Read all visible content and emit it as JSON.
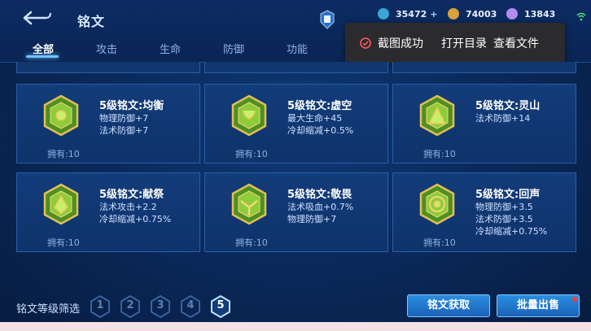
{
  "header": {
    "title": "铭文",
    "tabs": [
      {
        "label": "全部",
        "active": true
      },
      {
        "label": "攻击",
        "active": false
      },
      {
        "label": "生命",
        "active": false
      },
      {
        "label": "防御",
        "active": false
      },
      {
        "label": "功能",
        "active": false
      }
    ]
  },
  "currencies": [
    {
      "icon": "diamond-coupon-icon",
      "value": "35472",
      "plus": "+"
    },
    {
      "icon": "gold-coin-icon",
      "value": "74003"
    },
    {
      "icon": "crystal-icon",
      "value": "13843"
    }
  ],
  "toast": {
    "message": "截图成功",
    "open_dir": "打开目录",
    "view_file": "查看文件",
    "icon": "check-circle-icon"
  },
  "runes": [
    {
      "name": "5级铭文:均衡",
      "stats": [
        "物理防御+7",
        "法术防御+7"
      ],
      "owned": "拥有:10",
      "icon": "rune-balance-icon"
    },
    {
      "name": "5级铭文:虚空",
      "stats": [
        "最大生命+45",
        "冷却缩减+0.5%"
      ],
      "owned": "拥有:10",
      "icon": "rune-void-icon"
    },
    {
      "name": "5级铭文:灵山",
      "stats": [
        "法术防御+14"
      ],
      "owned": "拥有:10",
      "icon": "rune-spirit-mountain-icon"
    },
    {
      "name": "5级铭文:献祭",
      "stats": [
        "法术攻击+2.2",
        "冷却缩减+0.75%"
      ],
      "owned": "拥有:10",
      "icon": "rune-sacrifice-icon"
    },
    {
      "name": "5级铭文:敬畏",
      "stats": [
        "法术吸血+0.7%",
        "物理防御+7"
      ],
      "owned": "拥有:10",
      "icon": "rune-awe-icon"
    },
    {
      "name": "5级铭文:回声",
      "stats": [
        "物理防御+3.5",
        "法术防御+3.5",
        "冷却缩减+0.75%"
      ],
      "owned": "拥有:10",
      "icon": "rune-echo-icon"
    }
  ],
  "footer": {
    "filter_label": "铭文等级筛选",
    "levels": [
      "1",
      "2",
      "3",
      "4",
      "5"
    ],
    "active_level": "5",
    "acquire_label": "铭文获取",
    "sell_label": "批量出售"
  },
  "colors": {
    "accent": "#6fc4ff",
    "rune_green": "#5aa12a",
    "rune_gold": "#d8b24a"
  }
}
